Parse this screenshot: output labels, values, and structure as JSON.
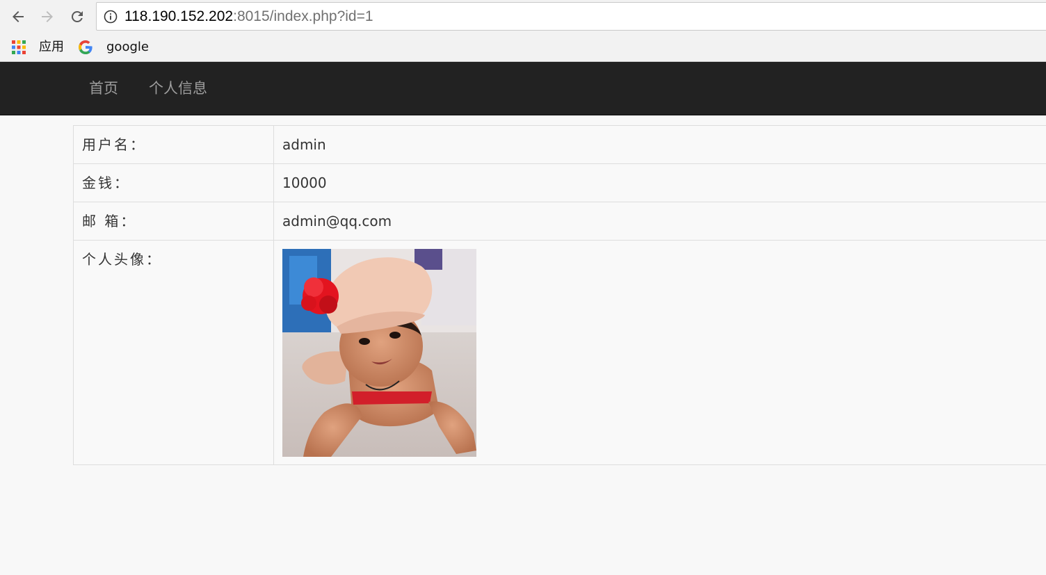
{
  "browser": {
    "url_host": "118.190.152.202",
    "url_rest": ":8015/index.php?id=1",
    "bookmarks": {
      "apps_label": "应用",
      "google_label": "google"
    }
  },
  "navbar": {
    "links": [
      {
        "label": "首页"
      },
      {
        "label": "个人信息"
      }
    ]
  },
  "profile": {
    "rows": [
      {
        "label": "用户名：",
        "value": "admin"
      },
      {
        "label": "金钱：",
        "value": "10000"
      },
      {
        "label": "邮 箱：",
        "value": "admin@qq.com"
      }
    ],
    "avatar_label": "个人头像："
  },
  "colors": {
    "navbar_bg": "#222222",
    "nav_link": "#9d9d9d",
    "table_border": "#dddddd"
  }
}
